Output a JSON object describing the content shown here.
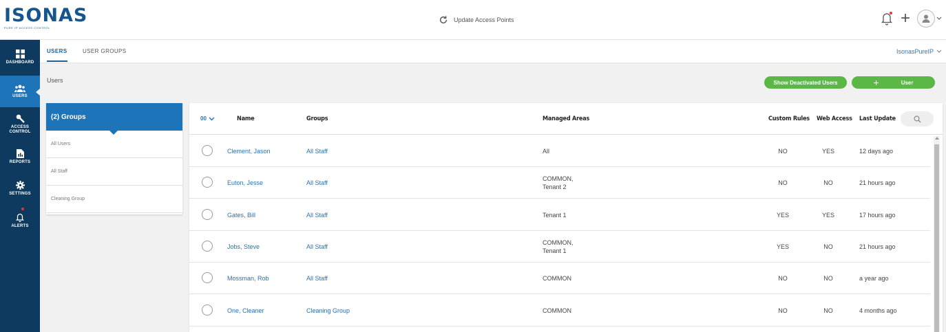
{
  "header": {
    "logo_text": "ISONAS",
    "logo_tagline": "PURE IP ACCESS CONTROL",
    "update_access_points": "Update Access Points"
  },
  "sidebar": {
    "items": [
      {
        "label": "DASHBOARD",
        "icon": "dashboard-icon"
      },
      {
        "label": "USERS",
        "icon": "users-icon",
        "active": true
      },
      {
        "label": "ACCESS CONTROL",
        "icon": "key-icon"
      },
      {
        "label": "REPORTS",
        "icon": "reports-icon"
      },
      {
        "label": "SETTINGS",
        "icon": "gear-icon"
      },
      {
        "label": "ALERTS",
        "icon": "bell-icon"
      }
    ]
  },
  "tabs": {
    "users": "USERS",
    "user_groups": "USER GROUPS",
    "org": "IsonasPureIP"
  },
  "breadcrumb": "Users",
  "buttons": {
    "show_deactivated": "Show Deactivated Users",
    "add_user": "User"
  },
  "groups": {
    "title": "(2) Groups",
    "items": [
      "All Users",
      "All Staff",
      "Cleaning Group"
    ]
  },
  "table": {
    "select_label": "00",
    "columns": [
      "Name",
      "Groups",
      "Managed Areas",
      "Custom Rules",
      "Web Access",
      "Last Update"
    ],
    "rows": [
      {
        "name": "Clement, Jason",
        "group": "All Staff",
        "areas": [
          "All"
        ],
        "custom": "NO",
        "web": "YES",
        "updated": "12 days ago"
      },
      {
        "name": "Euton, Jesse",
        "group": "All Staff",
        "areas": [
          "COMMON,",
          "Tenant 2"
        ],
        "custom": "NO",
        "web": "NO",
        "updated": "21 hours ago"
      },
      {
        "name": "Gates, Bill",
        "group": "All Staff",
        "areas": [
          "Tenant 1"
        ],
        "custom": "YES",
        "web": "YES",
        "updated": "17 hours ago"
      },
      {
        "name": "Jobs, Steve",
        "group": "All Staff",
        "areas": [
          "COMMON,",
          "Tenant 1"
        ],
        "custom": "YES",
        "web": "NO",
        "updated": "21 hours ago"
      },
      {
        "name": "Mossman, Rob",
        "group": "All Staff",
        "areas": [
          "COMMON"
        ],
        "custom": "NO",
        "web": "NO",
        "updated": "a year ago"
      },
      {
        "name": "One, Cleaner",
        "group": "Cleaning Group",
        "areas": [
          "COMMON"
        ],
        "custom": "NO",
        "web": "NO",
        "updated": "4 months ago"
      }
    ]
  },
  "colors": {
    "sidebar_bg": "#0e3a5f",
    "accent_blue": "#1e74b9",
    "link_blue": "#2a6fae",
    "green": "#5bb847",
    "alert_red": "#ee3333"
  }
}
